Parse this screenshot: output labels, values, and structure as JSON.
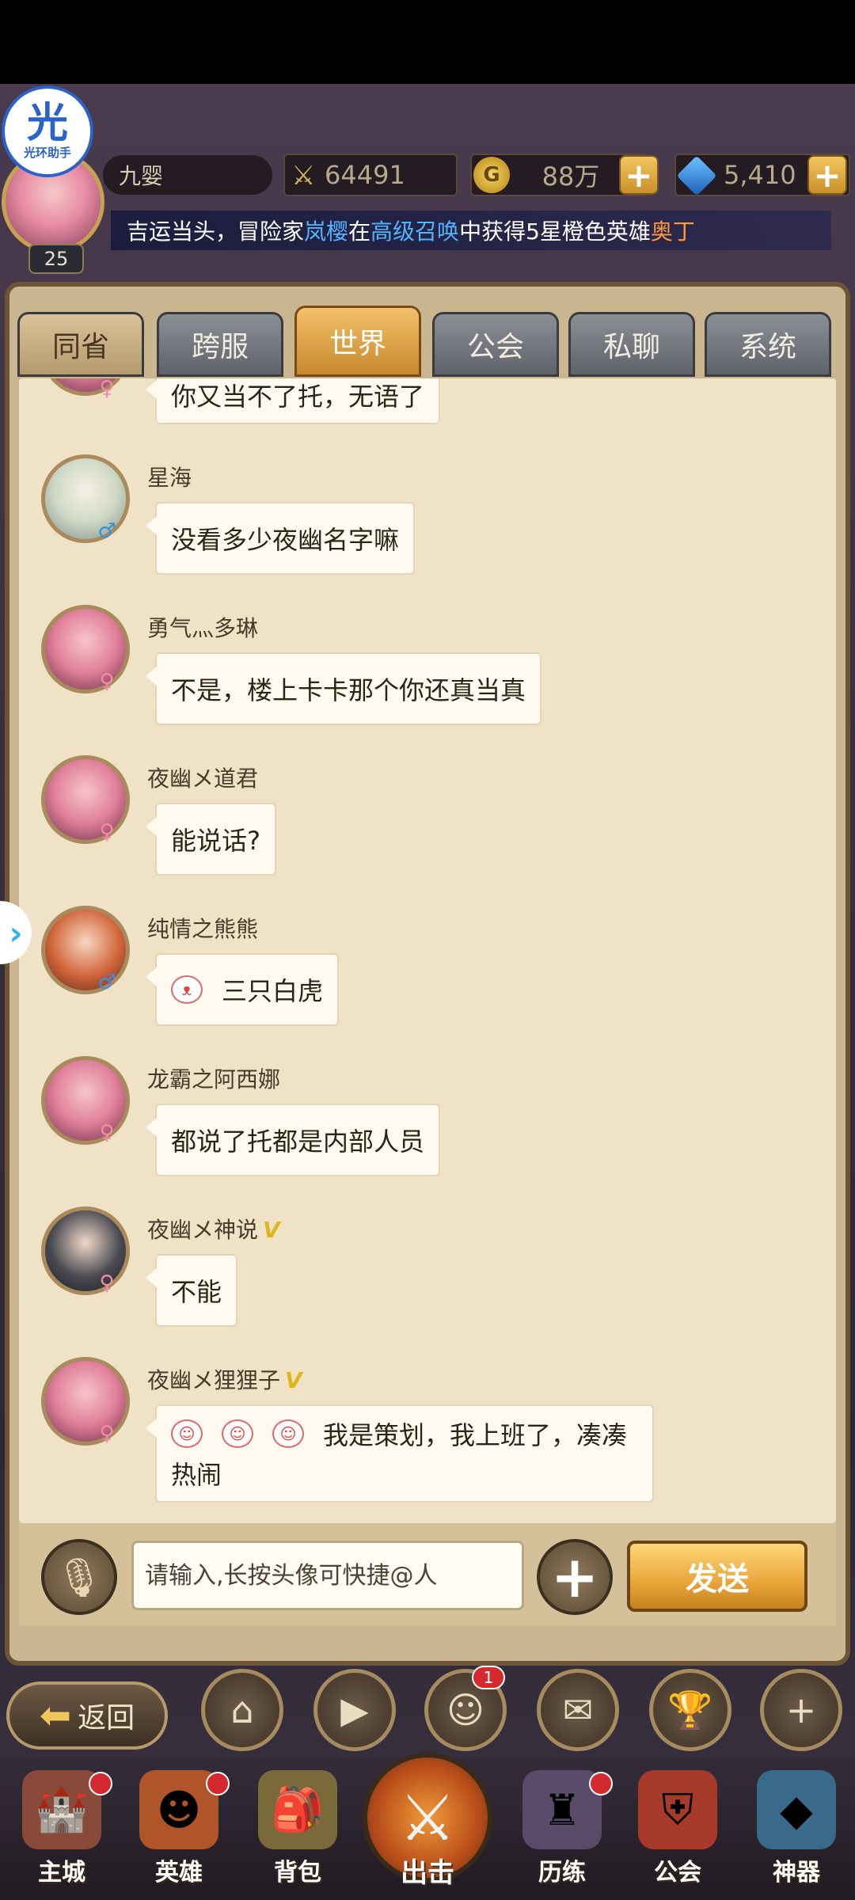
{
  "overlay": {
    "helper_logo_char": "光",
    "helper_logo_text": "光环助手"
  },
  "player": {
    "name": "九婴",
    "level": "25"
  },
  "resources": {
    "power": "64491",
    "gold": "88万",
    "gold_symbol": "G",
    "gems": "5,410"
  },
  "announcement": {
    "prefix": "吉运当头，冒险家",
    "player": "岚樱",
    "mid1": "在",
    "source": "高级召唤",
    "mid2": "中获得5星橙色英雄",
    "hero": "奥丁"
  },
  "tabs": [
    {
      "label": "同省"
    },
    {
      "label": "跨服"
    },
    {
      "label": "世界"
    },
    {
      "label": "公会"
    },
    {
      "label": "私聊"
    },
    {
      "label": "系统"
    }
  ],
  "active_tab": "世界",
  "messages": [
    {
      "nick": "",
      "text": "你又当不了托，无语了",
      "gender": "♀",
      "vip": ""
    },
    {
      "nick": "星海",
      "text": "没看多少夜幽名字嘛",
      "gender": "♂",
      "vip": ""
    },
    {
      "nick": "勇气灬多琳",
      "text": "不是，楼上卡卡那个你还真当真",
      "gender": "♀",
      "vip": ""
    },
    {
      "nick": "夜幽メ道君",
      "text": "能说话?",
      "gender": "♀",
      "vip": ""
    },
    {
      "nick": "纯情之熊熊",
      "text": "三只白虎",
      "gender": "♂",
      "vip": ""
    },
    {
      "nick": "龙霸之阿西娜",
      "text": "都说了托都是内部人员",
      "gender": "♀",
      "vip": ""
    },
    {
      "nick": "夜幽メ神说",
      "text": "不能",
      "gender": "♀",
      "vip": "V"
    },
    {
      "nick": "夜幽メ狸狸子",
      "text_line1": "我是策划，我上班了，凑凑",
      "text_line2": "热闹",
      "gender": "♀",
      "vip": "V"
    }
  ],
  "input": {
    "placeholder": "请输入,长按头像可快捷@人",
    "value": ""
  },
  "send_label": "发送",
  "back_label": "返回",
  "quick_buttons": {
    "friends_badge": "1"
  },
  "bottom_nav": [
    {
      "label": "主城"
    },
    {
      "label": "英雄"
    },
    {
      "label": "背包"
    },
    {
      "label": "出击"
    },
    {
      "label": "历练"
    },
    {
      "label": "公会"
    },
    {
      "label": "神器"
    }
  ]
}
